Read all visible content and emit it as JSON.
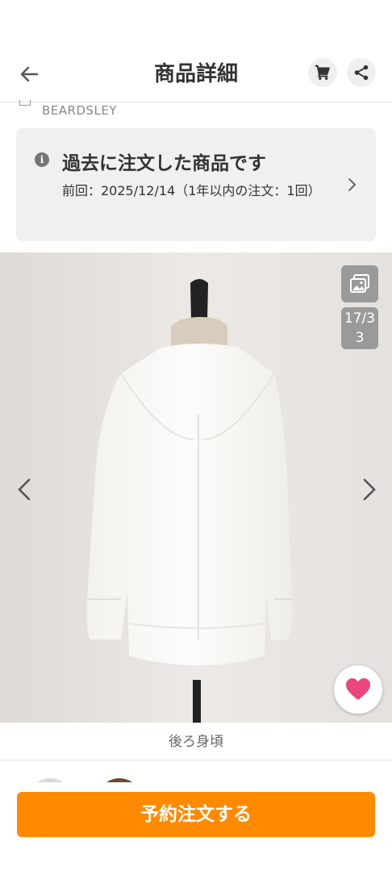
{
  "header": {
    "title": "商品詳細",
    "back_icon": "arrow-left-icon",
    "cart_icon": "cart-icon",
    "share_icon": "share-icon"
  },
  "brand": {
    "name": "BEARDSLEY"
  },
  "order_notice": {
    "title": "過去に注文した商品です",
    "detail": "前回：2025/12/14（1年以内の注文：1回）",
    "icon": "info-icon"
  },
  "gallery": {
    "counter": "17/33",
    "caption": "後ろ身頃",
    "image_subject": "white long-sleeve blouse on mannequin, back view",
    "images_icon": "image-gallery-icon",
    "favorite_icon": "heart-icon"
  },
  "footer": {
    "order_button": "予約注文する"
  },
  "colors": {
    "accent": "#ff8a00",
    "favorite": "#e8467c",
    "notice_bg": "#f0f0f0"
  }
}
